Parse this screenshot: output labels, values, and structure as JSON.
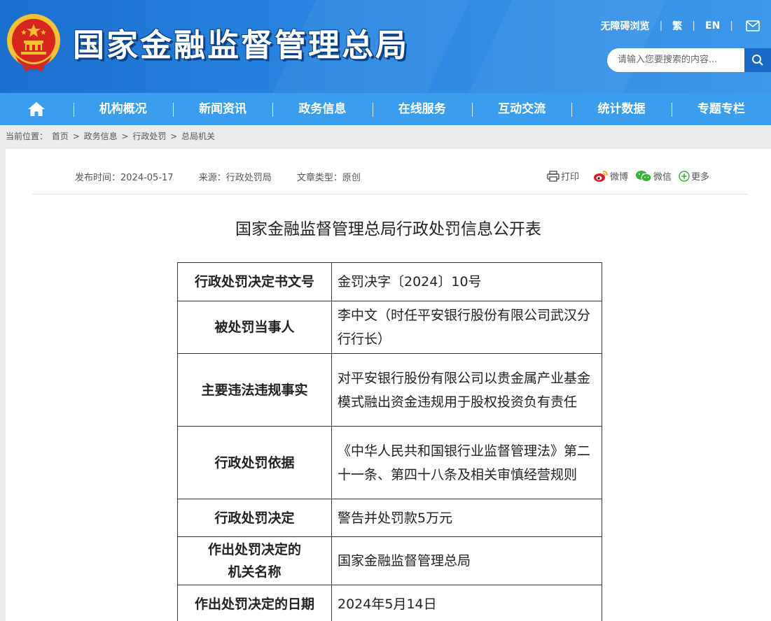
{
  "site": {
    "title": "国家金融监督管理总局"
  },
  "top_links": {
    "accessibility": "无障碍浏览",
    "traditional": "繁",
    "english": "EN"
  },
  "search": {
    "placeholder": "请输入您要搜索的内容..."
  },
  "nav": {
    "items": [
      "机构概况",
      "新闻资讯",
      "政务信息",
      "在线服务",
      "互动交流",
      "统计数据",
      "专题专栏"
    ]
  },
  "breadcrumb": {
    "prefix": "当前位置：",
    "items": [
      "首页",
      "政务信息",
      "行政处罚",
      "总局机关"
    ],
    "sep": ">"
  },
  "meta": {
    "publish_time": "发布时间：2024-05-17",
    "source": "来源：行政处罚局",
    "type": "文章类型：原创"
  },
  "share": {
    "print": "打印",
    "weibo": "微博",
    "wechat": "微信",
    "more": "更多"
  },
  "document": {
    "title": "国家金融监督管理总局行政处罚信息公开表",
    "rows": [
      {
        "label": "行政处罚决定书文号",
        "value": "金罚决字〔2024〕10号"
      },
      {
        "label": "被处罚当事人",
        "value": "李中文（时任平安银行股份有限公司武汉分行行长）"
      },
      {
        "label": "主要违法违规事实",
        "value": "对平安银行股份有限公司以贵金属产业基金模式融出资金违规用于股权投资负有责任"
      },
      {
        "label": "行政处罚依据",
        "value": "《中华人民共和国银行业监督管理法》第二十一条、第四十八条及相关审慎经营规则"
      },
      {
        "label": "行政处罚决定",
        "value": "警告并处罚款5万元"
      },
      {
        "label_lines": [
          "作出处罚决定的",
          "机关名称"
        ],
        "value": "国家金融监督管理总局"
      },
      {
        "label": "作出处罚决定的日期",
        "value": "2024年5月14日"
      }
    ]
  },
  "colors": {
    "header_blue": "#2a86e2",
    "nav_blue": "#3b9ded",
    "emblem_red": "#d7261e",
    "emblem_gold": "#f2c230"
  }
}
